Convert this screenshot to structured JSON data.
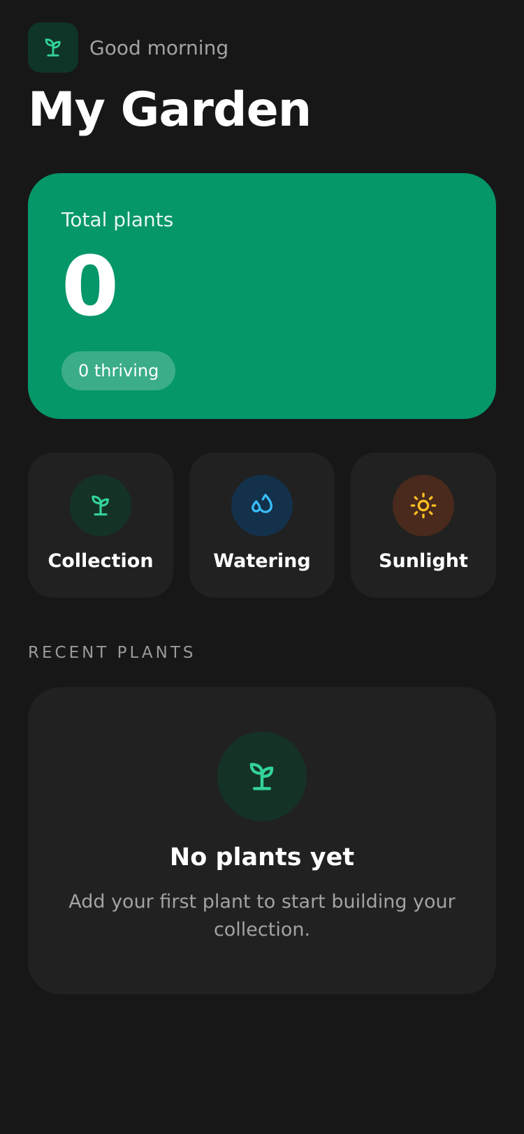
{
  "header": {
    "greeting": "Good morning",
    "title": "My Garden",
    "app_icon": "seedling-icon"
  },
  "stats": {
    "label": "Total plants",
    "total": "0",
    "thriving": "0 thriving"
  },
  "tiles": [
    {
      "label": "Collection",
      "icon": "seedling-icon",
      "color": "#34d399",
      "bg": "#143326"
    },
    {
      "label": "Watering",
      "icon": "droplets-icon",
      "color": "#38bdf8",
      "bg": "#13314a"
    },
    {
      "label": "Sunlight",
      "icon": "sun-icon",
      "color": "#fbbf24",
      "bg": "#4a2a1c"
    }
  ],
  "recent": {
    "heading": "RECENT PLANTS",
    "empty_title": "No plants yet",
    "empty_description": "Add your first plant to start building your collection.",
    "empty_icon": "seedling-icon"
  },
  "colors": {
    "background": "#171717",
    "accent": "#059669",
    "card": "#212121"
  }
}
